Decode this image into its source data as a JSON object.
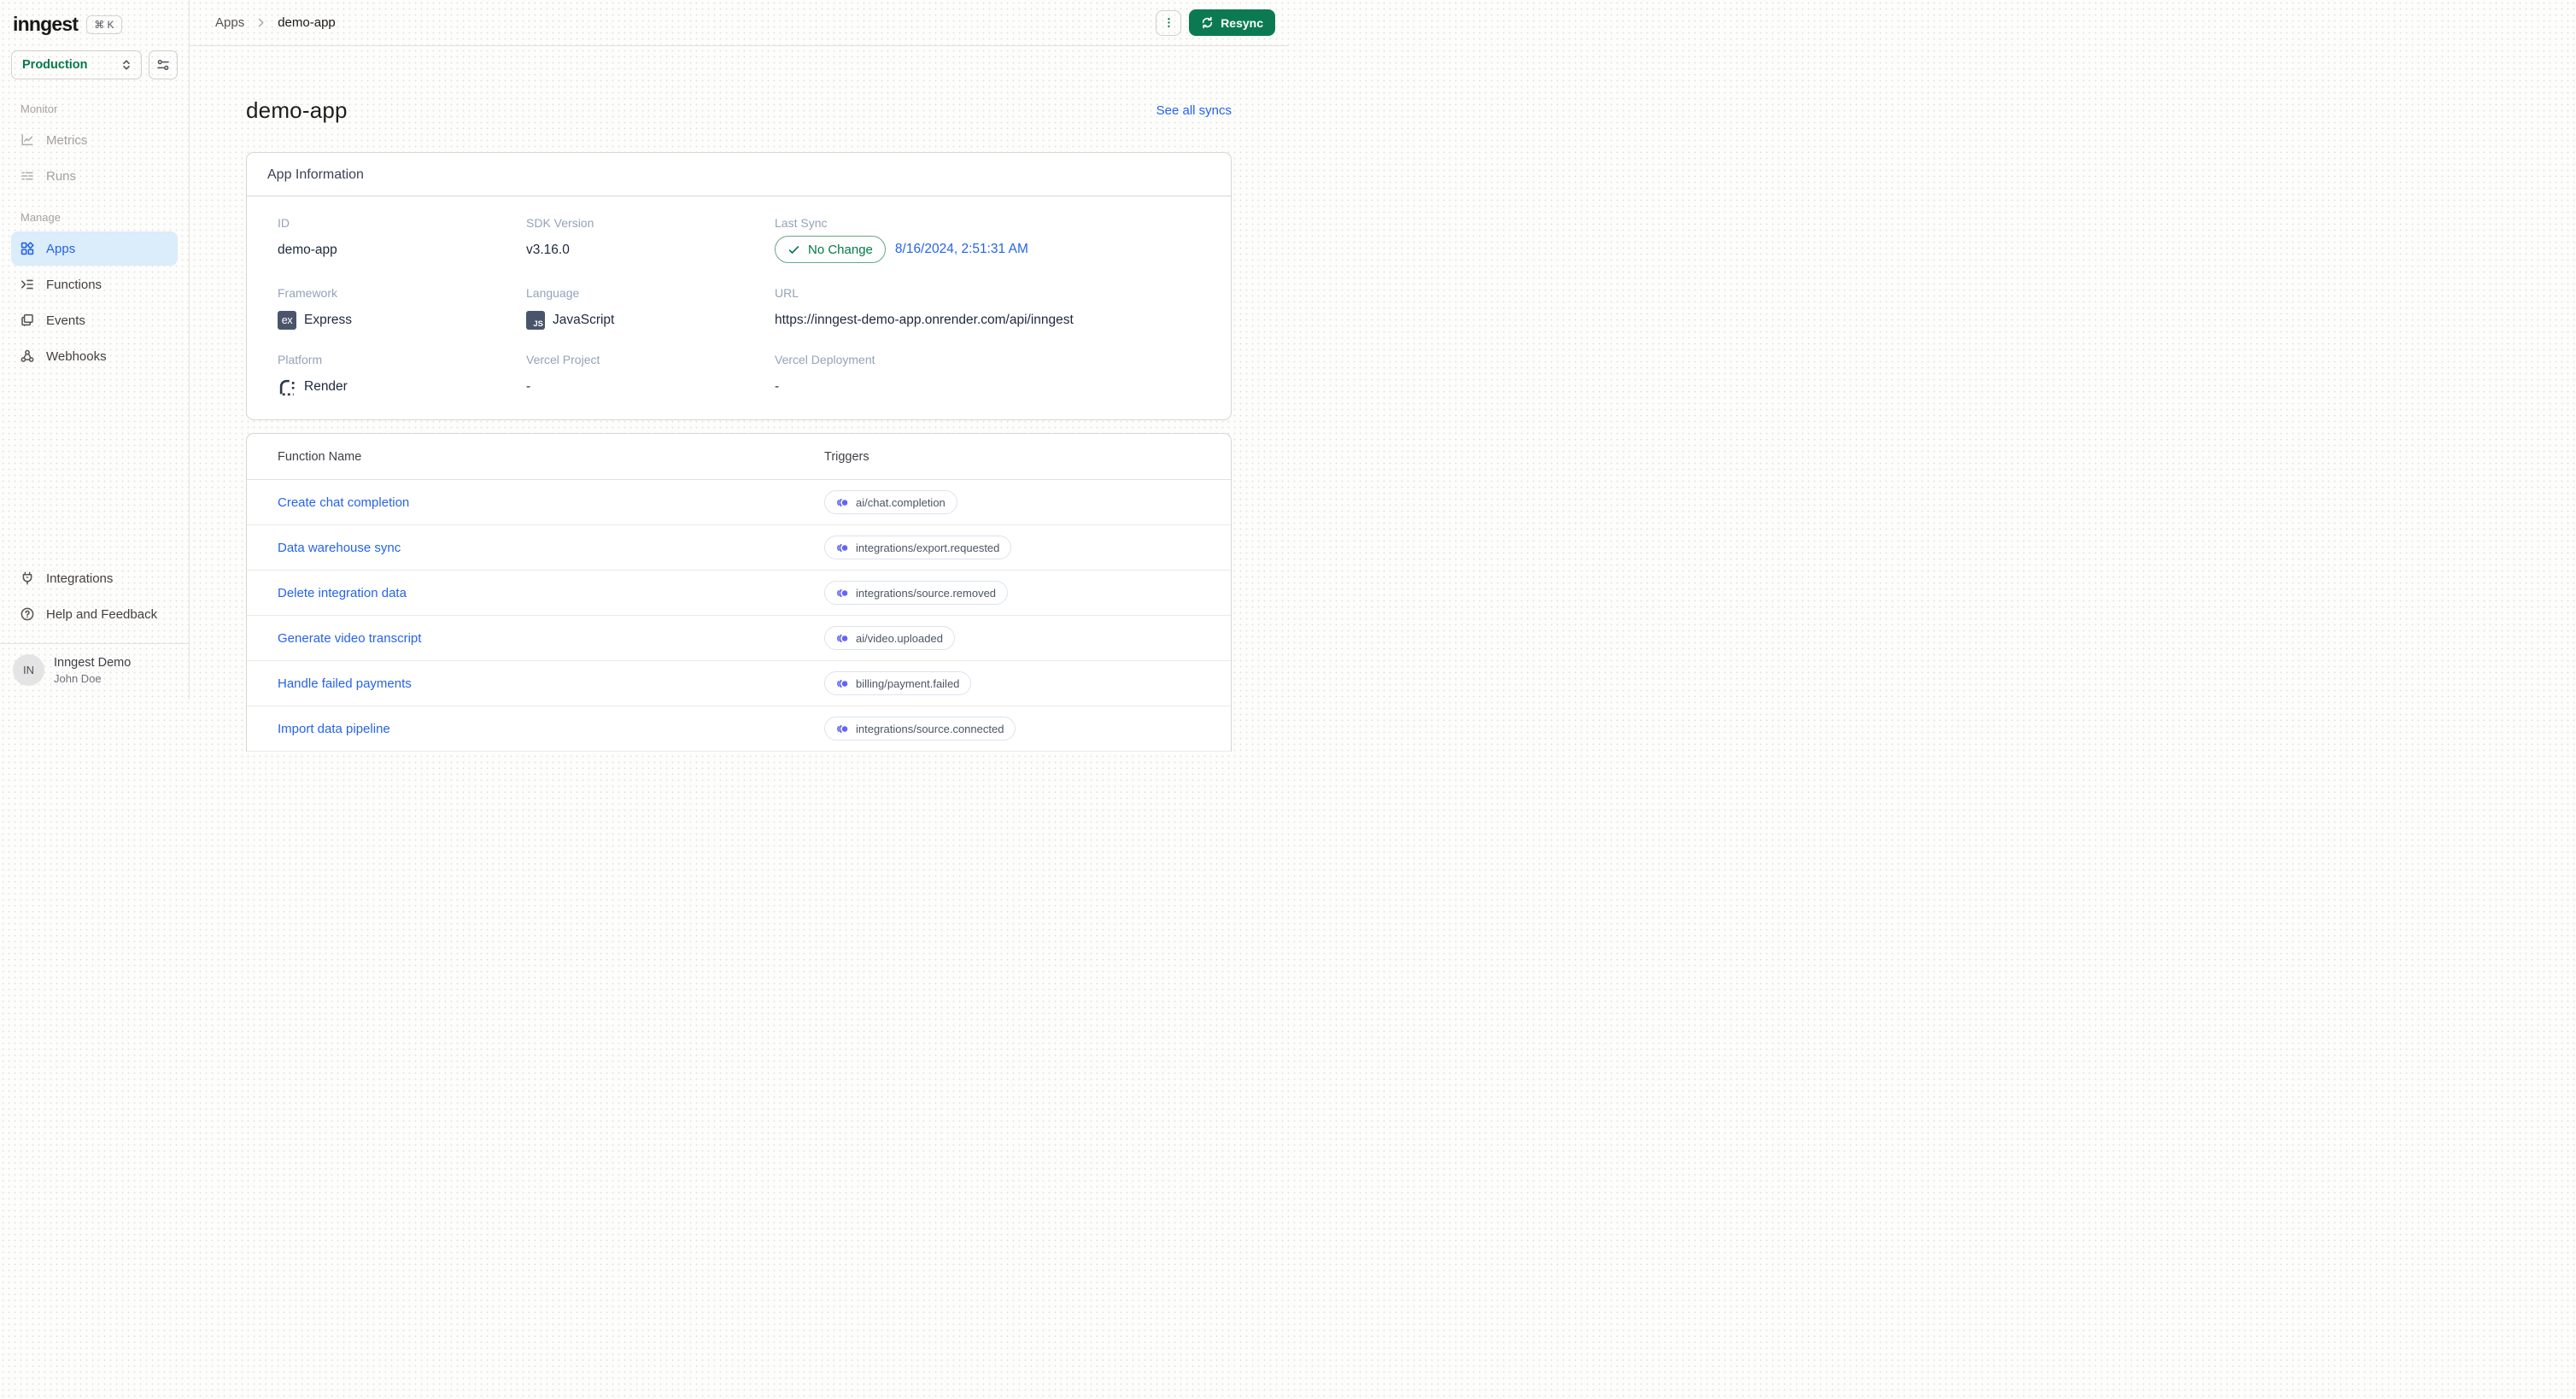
{
  "colors": {
    "accent_green": "#0b7a52",
    "env_green": "#027a48",
    "link_blue": "#2563eb",
    "trigger_indigo": "#6366f1",
    "active_nav_bg": "#dbecfb"
  },
  "sidebar": {
    "logo": "inngest",
    "shortcut": "⌘ K",
    "environment": "Production",
    "monitor": {
      "label": "Monitor",
      "metrics": "Metrics",
      "runs": "Runs"
    },
    "manage": {
      "label": "Manage",
      "apps": "Apps",
      "functions": "Functions",
      "events": "Events",
      "webhooks": "Webhooks"
    },
    "footer": {
      "integrations": "Integrations",
      "help": "Help and Feedback"
    },
    "user": {
      "initials": "IN",
      "org": "Inngest Demo",
      "name": "John Doe"
    }
  },
  "topbar": {
    "breadcrumb_root": "Apps",
    "breadcrumb_current": "demo-app",
    "resync": "Resync"
  },
  "page": {
    "title": "demo-app",
    "see_all_syncs": "See all syncs"
  },
  "app_info": {
    "title": "App Information",
    "id": {
      "label": "ID",
      "value": "demo-app"
    },
    "sdk": {
      "label": "SDK Version",
      "value": "v3.16.0"
    },
    "last_sync": {
      "label": "Last Sync",
      "badge": "No Change",
      "timestamp": "8/16/2024, 2:51:31 AM"
    },
    "framework": {
      "label": "Framework",
      "value": "Express",
      "chip": "ex"
    },
    "language": {
      "label": "Language",
      "value": "JavaScript",
      "chip": "JS"
    },
    "url": {
      "label": "URL",
      "value": "https://inngest-demo-app.onrender.com/api/inngest"
    },
    "platform": {
      "label": "Platform",
      "value": "Render"
    },
    "vercel_project": {
      "label": "Vercel Project",
      "value": "-"
    },
    "vercel_deployment": {
      "label": "Vercel Deployment",
      "value": "-"
    }
  },
  "functions_table": {
    "col_name": "Function Name",
    "col_triggers": "Triggers",
    "rows": [
      {
        "name": "Create chat completion",
        "trigger": "ai/chat.completion"
      },
      {
        "name": "Data warehouse sync",
        "trigger": "integrations/export.requested"
      },
      {
        "name": "Delete integration data",
        "trigger": "integrations/source.removed"
      },
      {
        "name": "Generate video transcript",
        "trigger": "ai/video.uploaded"
      },
      {
        "name": "Handle failed payments",
        "trigger": "billing/payment.failed"
      },
      {
        "name": "Import data pipeline",
        "trigger": "integrations/source.connected"
      }
    ]
  }
}
